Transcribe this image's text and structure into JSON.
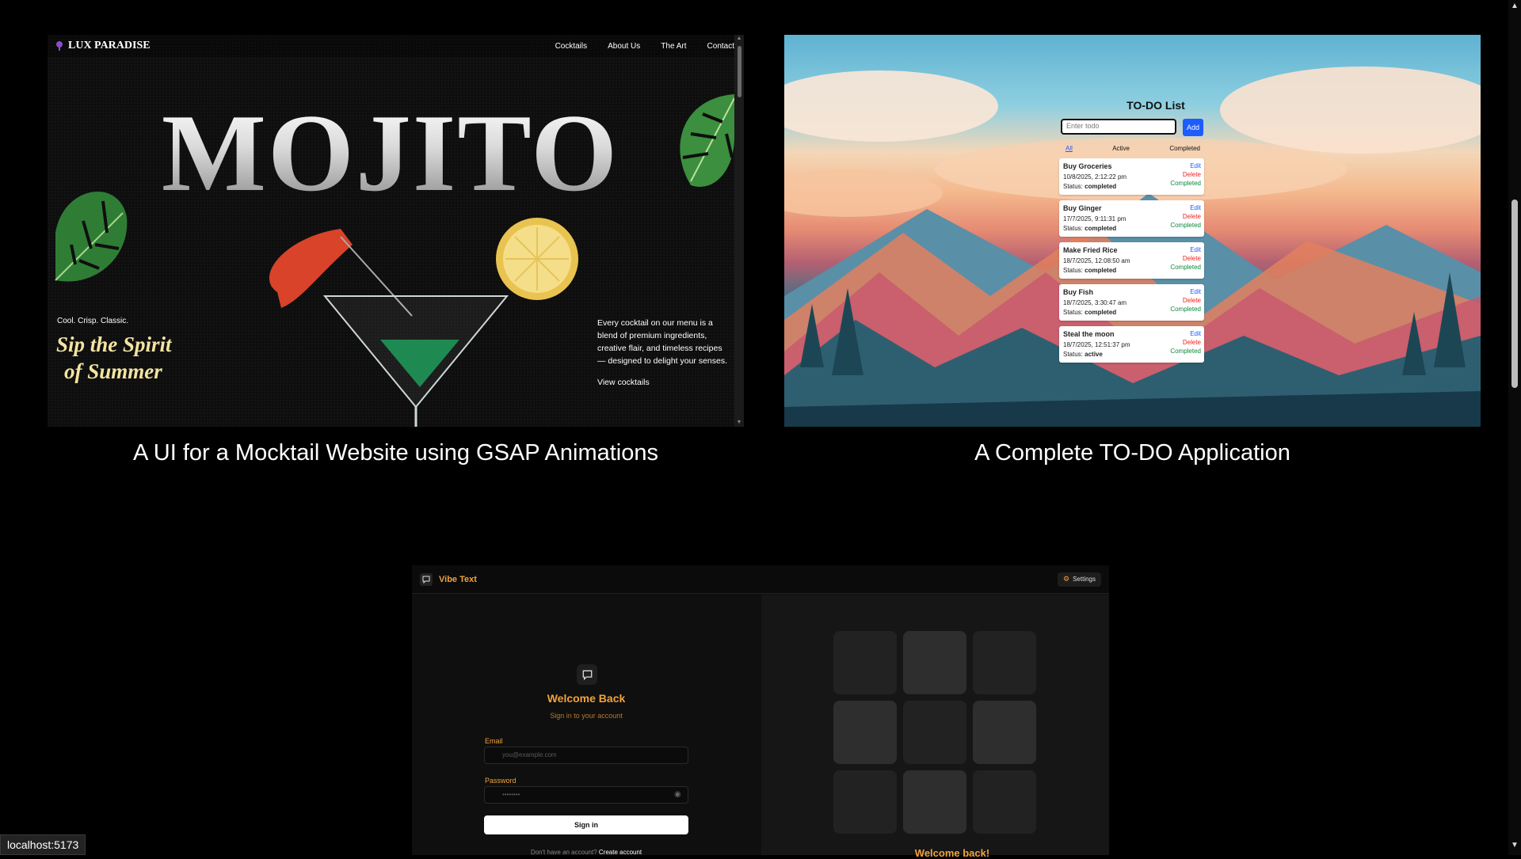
{
  "projects": [
    {
      "caption": "A UI for a Mocktail Website using GSAP Animations",
      "preview": {
        "logo": "LUX PARADISE",
        "nav": [
          "Cocktails",
          "About Us",
          "The Art",
          "Contact"
        ],
        "hero_title": "MOJITO",
        "tagline": "Cool. Crisp. Classic.",
        "headline_1": "Sip the Spirit",
        "headline_2": "of Summer",
        "description": "Every cocktail on our menu is a blend of premium ingredients, creative flair, and timeless recipes — designed to delight your senses.",
        "cta": "View cocktails"
      }
    },
    {
      "caption": "A Complete TO-DO Application",
      "preview": {
        "title": "TO-DO List",
        "input_placeholder": "Enter todo",
        "add_label": "Add",
        "filters": [
          "All",
          "Active",
          "Completed"
        ],
        "actions": {
          "edit": "Edit",
          "delete": "Delete",
          "complete": "Completed"
        },
        "status_prefix": "Status:",
        "items": [
          {
            "name": "Buy Groceries",
            "date": "10/8/2025, 2:12:22 pm",
            "status": "completed"
          },
          {
            "name": "Buy Ginger",
            "date": "17/7/2025, 9:11:31 pm",
            "status": "completed"
          },
          {
            "name": "Make Fried Rice",
            "date": "18/7/2025, 12:08:50 am",
            "status": "completed"
          },
          {
            "name": "Buy Fish",
            "date": "18/7/2025, 3:30:47 am",
            "status": "completed"
          },
          {
            "name": "Steal the moon",
            "date": "18/7/2025, 12:51:37 pm",
            "status": "active"
          }
        ]
      }
    },
    {
      "caption": "",
      "preview": {
        "brand": "Vibe Text",
        "settings_label": "Settings",
        "welcome": "Welcome Back",
        "subtitle": "Sign in to your account",
        "email_label": "Email",
        "email_placeholder": "you@example.com",
        "password_label": "Password",
        "password_mask": "••••••••",
        "signin_label": "Sign in",
        "signup_prompt": "Don't have an account?",
        "signup_link": "Create account",
        "right_title": "Welcome back!"
      }
    }
  ],
  "status_bar": {
    "url": "localhost:5173"
  },
  "colors": {
    "accent": "#f0a33a",
    "todo_blue": "#1d5cff",
    "todo_red": "#e22222",
    "todo_green": "#0a8a3a",
    "mojito_gold": "#f4e4a1"
  },
  "icons": [
    "logo-emblem-icon",
    "chat-bubble-icon",
    "gear-icon",
    "eye-icon",
    "scroll-up-arrow-icon",
    "scroll-down-arrow-icon"
  ]
}
